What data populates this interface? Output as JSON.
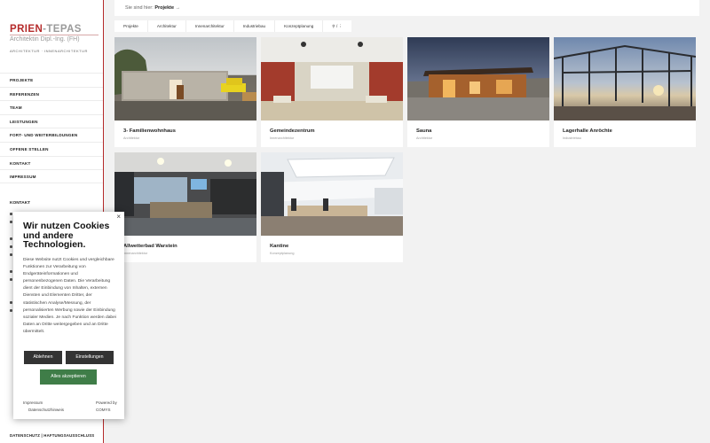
{
  "brand": {
    "name_part1": "PRIEN",
    "name_part2": "-TEPAS",
    "subtitle": "Architektin Dipl.-Ing. (FH)",
    "tagline": "ARCHITEKTUR · INNENARCHITEKTUR"
  },
  "nav": {
    "items": [
      "PROJEKTE",
      "REFERENZEN",
      "TEAM",
      "LEISTUNGEN",
      "FORT- UND WEITERBILDUNGEN",
      "OFFENE STELLEN",
      "KONTAKT",
      "IMPRESSUM"
    ]
  },
  "sidebar": {
    "contact_heading": "KONTAKT",
    "footer_links": "DATENSCHUTZ | HAFTUNGSAUSSCHLUSS"
  },
  "breadcrumb": {
    "prefix": "Sie sind hier:",
    "current": "Projekte",
    "arrow": "→"
  },
  "filters": [
    "Projekte",
    "Architektur",
    "Innenarchitektur",
    "Industriebau",
    "Konzeptplanung",
    "⚲ / ⋮"
  ],
  "projects": [
    {
      "title": "3- Familienwohnhaus",
      "category": "Architektur"
    },
    {
      "title": "Gemeindezentrum",
      "category": "Innenarchitektur"
    },
    {
      "title": "Sauna",
      "category": "Architektur"
    },
    {
      "title": "Lagerhalle Anröchte",
      "category": "Industriebau"
    },
    {
      "title": "Allwetterbad Warstein",
      "category": "Innenarchitektur"
    },
    {
      "title": "Kantine",
      "category": "Konzeptplanung"
    }
  ],
  "cookie": {
    "close": "×",
    "title": "Wir nutzen Cookies und andere Technologien.",
    "text": "Diese Website nutzt Cookies und vergleichbare Funktionen zur Verarbeitung von Endgeräteinformationen und personenbezogenen Daten. Die Verarbeitung dient der Einbindung von Inhalten, externen Diensten und Elementen Dritter, der statistischen Analyse/Messung, der personalisierten Werbung sowie der Einbindung sozialer Medien. Je nach Funktion werden dabei Daten an Dritte weitergegeben und an Dritte übermittelt.",
    "decline": "Ablehnen",
    "settings": "Einstellungen",
    "accept": "Alles akzeptieren",
    "impressum": "Impressum",
    "datenschutz": "Datenschutzhinweis",
    "powered": "Powered by",
    "powered_brand": "COMYS"
  }
}
